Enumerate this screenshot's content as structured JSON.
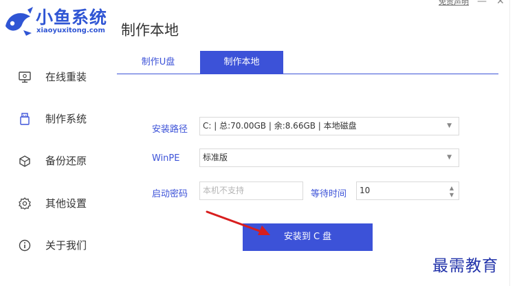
{
  "app": {
    "logo_cn": "小鱼系统",
    "logo_en": "xiaoyuxitong.com",
    "page_title": "制作本地",
    "disclaimer_link": "免责声明",
    "minimize_glyph": "—",
    "close_glyph": "✕"
  },
  "sidebar": {
    "items": [
      {
        "label": "在线重装",
        "icon": "monitor-icon"
      },
      {
        "label": "制作系统",
        "icon": "usb-drive-icon"
      },
      {
        "label": "备份还原",
        "icon": "backup-box-icon"
      },
      {
        "label": "其他设置",
        "icon": "gear-icon"
      },
      {
        "label": "关于我们",
        "icon": "info-icon"
      }
    ]
  },
  "tabs": [
    {
      "label": "制作U盘",
      "active": false
    },
    {
      "label": "制作本地",
      "active": true
    }
  ],
  "form": {
    "install_path_label": "安装路径",
    "install_path_value": "C: | 总:70.00GB | 余:8.66GB | 本地磁盘",
    "winpe_label": "WinPE",
    "winpe_value": "标准版",
    "boot_password_label": "启动密码",
    "boot_password_placeholder": "本机不支持",
    "wait_time_label": "等待时间",
    "wait_time_value": "10"
  },
  "install_button": "安装到 C 盘",
  "watermark": "最需教育",
  "colors": {
    "accent": "#3c52d8",
    "logo": "#2f55d4",
    "arrow": "#d81e1e"
  }
}
